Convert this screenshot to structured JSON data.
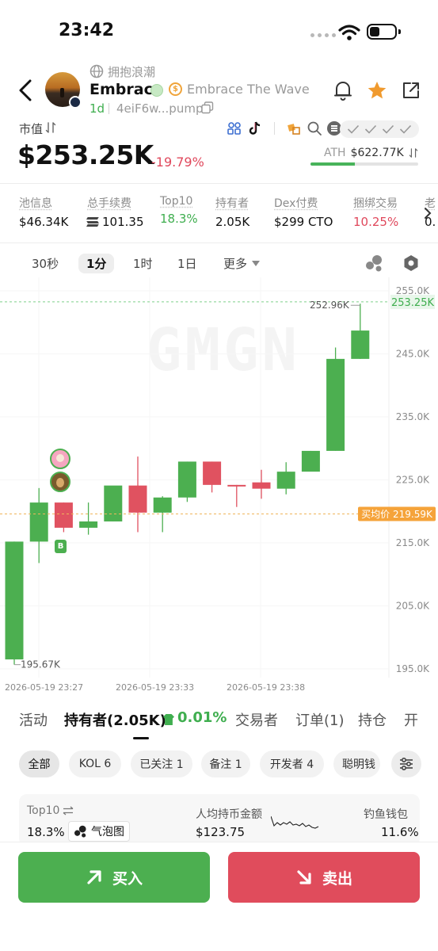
{
  "status_bar": {
    "time": "23:42"
  },
  "token": {
    "subtitle": "拥抱浪潮",
    "name": "Embrace",
    "full_name": "Embrace The Wave",
    "age": "1d",
    "address": "4eiF6w...pump"
  },
  "market": {
    "label": "市值",
    "value": "$253.25K",
    "change": "-19.79%",
    "ath_label": "ATH",
    "ath_value": "$622.77K",
    "ath_progress": 0.41
  },
  "stats": [
    {
      "label": "池信息",
      "value": "$46.34K"
    },
    {
      "label": "总手续费",
      "value": "101.35"
    },
    {
      "label": "Top10",
      "value": "18.3%"
    },
    {
      "label": "持有者",
      "value": "2.05K"
    },
    {
      "label": "Dex付费",
      "value": "$299 CTO"
    },
    {
      "label": "捆绑交易",
      "value": "10.25%"
    },
    {
      "label": "老",
      "value": "0."
    }
  ],
  "timeframes": [
    "30秒",
    "1分",
    "1时",
    "1日",
    "更多"
  ],
  "active_timeframe": "1分",
  "watermark": "GMGN",
  "chart_data": {
    "type": "candlestick",
    "y_ticks": [
      "255.0K",
      "245.0K",
      "235.0K",
      "225.0K",
      "215.0K",
      "205.0K",
      "195.0K"
    ],
    "ylim": [
      195000,
      255000
    ],
    "x_ticks": [
      "2026-05-19 23:27",
      "2026-05-19 23:33",
      "2026-05-19 23:38"
    ],
    "high_label": "252.96K",
    "low_label": "195.67K",
    "current_price": "253.25K",
    "avg_price_label": "买均价",
    "avg_price": "219.59K",
    "avg_price_value": 219590,
    "current_value": 253250,
    "candles": [
      {
        "o": 196500,
        "h": 215200,
        "l": 195670,
        "c": 215200
      },
      {
        "o": 215200,
        "h": 223700,
        "l": 211800,
        "c": 221400
      },
      {
        "o": 221400,
        "h": 221400,
        "l": 216700,
        "c": 217400
      },
      {
        "o": 217400,
        "h": 221400,
        "l": 216300,
        "c": 218400
      },
      {
        "o": 218400,
        "h": 223700,
        "l": 218400,
        "c": 224100
      },
      {
        "o": 224100,
        "h": 228700,
        "l": 216700,
        "c": 219800
      },
      {
        "o": 219800,
        "h": 222400,
        "l": 216700,
        "c": 222200
      },
      {
        "o": 222200,
        "h": 227900,
        "l": 221500,
        "c": 227900
      },
      {
        "o": 227900,
        "h": 227900,
        "l": 223000,
        "c": 224200
      },
      {
        "o": 224200,
        "h": 224200,
        "l": 220700,
        "c": 224100
      },
      {
        "o": 224600,
        "h": 226600,
        "l": 222000,
        "c": 223600
      },
      {
        "o": 223600,
        "h": 227800,
        "l": 222700,
        "c": 226300
      },
      {
        "o": 226300,
        "h": 229600,
        "l": 228200,
        "c": 229600
      },
      {
        "o": 229600,
        "h": 246000,
        "l": 229600,
        "c": 244200
      },
      {
        "o": 244200,
        "h": 252960,
        "l": 244200,
        "c": 248700
      }
    ]
  },
  "tabs": [
    {
      "label": "活动"
    },
    {
      "label": "持有者(2.05K)"
    },
    {
      "label": "0.01%"
    },
    {
      "label": "交易者"
    },
    {
      "label": "订单(1)"
    },
    {
      "label": "持仓"
    },
    {
      "label": "开"
    }
  ],
  "filters": [
    "全部",
    "KOL 6",
    "已关注 1",
    "备注 1",
    "开发者 4",
    "聪明钱"
  ],
  "holders_summary": {
    "top10_label": "Top10",
    "top10_value": "18.3%",
    "bubble_label": "气泡图",
    "avg_hold_label": "人均持币金额",
    "avg_hold_value": "$123.75",
    "phishing_label": "钓鱼钱包",
    "phishing_value": "11.6%"
  },
  "actions": {
    "buy": "买入",
    "sell": "卖出"
  },
  "colors": {
    "up": "#4caf50",
    "down": "#e05260",
    "accent": "#f09a2e",
    "brand_green": "#3fae4f"
  }
}
